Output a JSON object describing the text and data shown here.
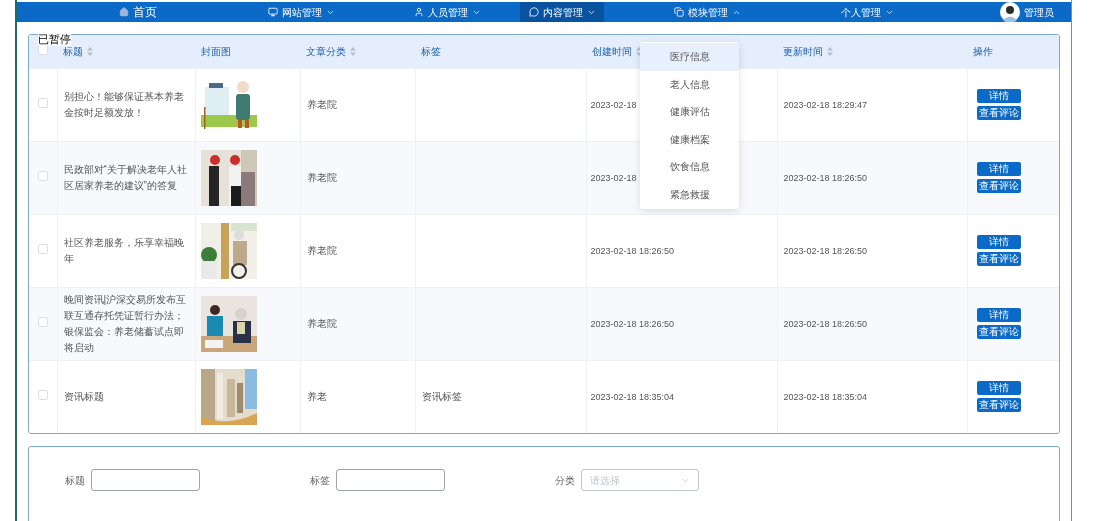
{
  "nav": [
    {
      "label": "首页",
      "selected": false
    },
    {
      "label": "网站管理",
      "selected": false,
      "expanded": false
    },
    {
      "label": "人员管理",
      "selected": false,
      "expanded": false
    },
    {
      "label": "内容管理",
      "selected": true,
      "expanded": false
    },
    {
      "label": "模块管理",
      "selected": false,
      "expanded": true
    },
    {
      "label": "个人管理",
      "selected": false,
      "expanded": false
    }
  ],
  "user": {
    "name": "管理员"
  },
  "pause_label": "已暂停",
  "dropdown": [
    {
      "label": "医疗信息",
      "selected": true
    },
    {
      "label": "老人信息",
      "selected": false
    },
    {
      "label": "健康评估",
      "selected": false
    },
    {
      "label": "健康档案",
      "selected": false
    },
    {
      "label": "饮食信息",
      "selected": false
    },
    {
      "label": "紧急救援",
      "selected": false
    }
  ],
  "table": {
    "select_all": {
      "checked": false
    },
    "columns": [
      {
        "label": "标题",
        "sortable": true
      },
      {
        "label": "封面图",
        "sortable": false
      },
      {
        "label": "文章分类",
        "sortable": true
      },
      {
        "label": "标签",
        "sortable": false
      },
      {
        "label": "创建时间",
        "sortable": true
      },
      {
        "label": "更新时间",
        "sortable": true
      },
      {
        "label": "操作",
        "sortable": false
      }
    ],
    "rows": [
      {
        "checked": false,
        "title": "别担心！能够保证基本养老金按时足额发放！",
        "cover": {
          "kind": "picture"
        },
        "category": "养老院",
        "created": "2023-02-18",
        "updated": "2023-02-18 18:29:47",
        "actions": [
          "详情",
          "查看评论"
        ]
      },
      {
        "checked": false,
        "title": "民政部对“关于解决老年人社区居家养老的建议”的答复",
        "cover": {
          "kind": "picture"
        },
        "category": "养老院",
        "created": "2023-02-18",
        "updated": "2023-02-18 18:26:50",
        "actions": [
          "详情",
          "查看评论"
        ]
      },
      {
        "checked": false,
        "title": "社区养老服务，乐享幸福晚年",
        "cover": {
          "kind": "picture"
        },
        "category": "养老院",
        "created": "2023-02-18 18:26:50",
        "updated": "2023-02-18 18:26:50",
        "actions": [
          "详情",
          "查看评论"
        ]
      },
      {
        "checked": false,
        "title": "晚间资讯|沪深交易所发布互联互通存托凭证暂行办法；银保监会：养老储蓄试点即将启动",
        "cover": {
          "kind": "picture"
        },
        "category": "养老院",
        "created": "2023-02-18 18:26:50",
        "updated": "2023-02-18 18:26:50",
        "actions": [
          "详情",
          "查看评论"
        ]
      },
      {
        "checked": false,
        "title": "资讯标题",
        "cover": {
          "kind": "picture"
        },
        "category": "养老",
        "tags": "资讯标签",
        "created": "2023-02-18 18:35:04",
        "updated": "2023-02-18 18:35:04",
        "actions": [
          "详情",
          "查看评论"
        ]
      }
    ]
  },
  "filters": [
    {
      "kind": "text",
      "label": "标题"
    },
    {
      "kind": "text",
      "label": "标签"
    },
    {
      "kind": "select",
      "label": "分类",
      "placeholder": "请选择"
    }
  ]
}
